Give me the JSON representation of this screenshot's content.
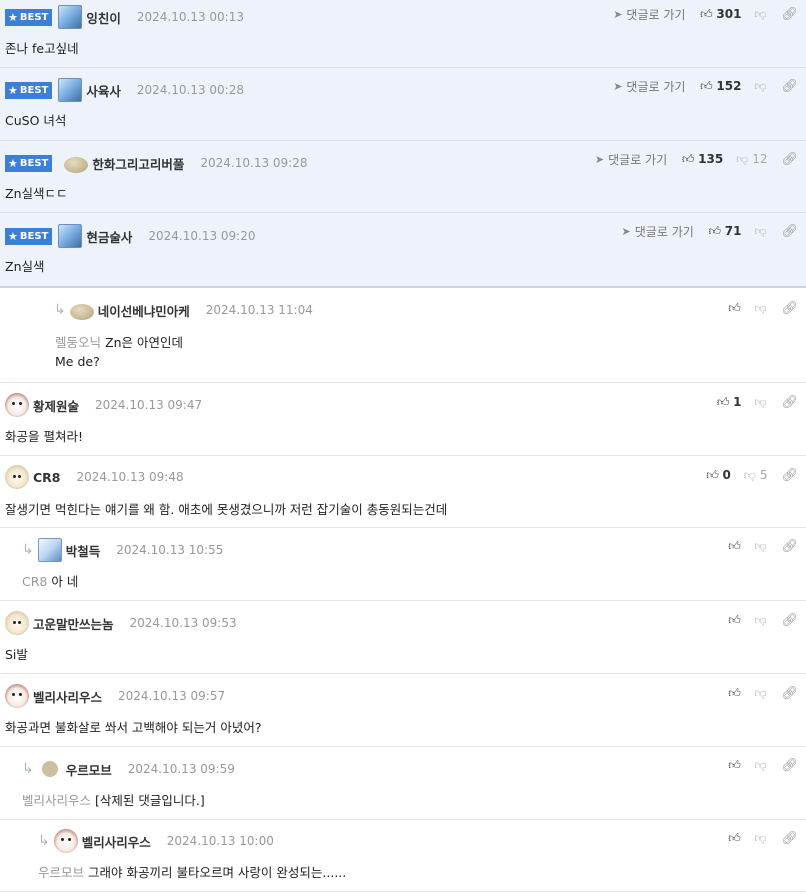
{
  "ui": {
    "best_label": "BEST",
    "goto_label": "댓글로 가기"
  },
  "comments": [
    {
      "nick": "잉친이",
      "date": "2024.10.13 00:13",
      "text": "존나 fe고싶네",
      "up": "301",
      "down": "",
      "best": true
    },
    {
      "nick": "사육사",
      "date": "2024.10.13 00:28",
      "text": "CuSO 녀석",
      "up": "152",
      "down": "",
      "best": true
    },
    {
      "nick": "한화그리고리버풀",
      "date": "2024.10.13 09:28",
      "text": "Zn실색ㄷㄷ",
      "up": "135",
      "down": "12",
      "best": true
    },
    {
      "nick": "현금술사",
      "date": "2024.10.13 09:20",
      "text": "Zn실색",
      "up": "71",
      "down": "",
      "best": true
    },
    {
      "nick": "네이선베냐민아케",
      "date": "2024.10.13 11:04",
      "mention": "렐둥오닉",
      "text": "Zn은 아연인데",
      "text2": "Me de?"
    },
    {
      "nick": "황제원술",
      "date": "2024.10.13 09:47",
      "text": "화공을 펼쳐라!",
      "up": "1",
      "down": ""
    },
    {
      "nick": "CR8",
      "date": "2024.10.13 09:48",
      "text": "잘생기면 먹힌다는 얘기를 왜 함. 애초에 못생겼으니까 저런 잡기술이 총동원되는건데",
      "up": "0",
      "down": "5"
    },
    {
      "nick": "박철득",
      "date": "2024.10.13 10:55",
      "mention": "CR8",
      "text": "아 네"
    },
    {
      "nick": "고운말만쓰는놈",
      "date": "2024.10.13 09:53",
      "text": "Si발"
    },
    {
      "nick": "벨리사리우스",
      "date": "2024.10.13 09:57",
      "text": "화공과면 불화살로 쏴서 고백해야 되는거 아녔어?"
    },
    {
      "nick": "우르모브",
      "date": "2024.10.13 09:59",
      "mention": "벨리사리우스",
      "text": "[삭제된 댓글입니다.]"
    },
    {
      "nick": "벨리사리우스",
      "date": "2024.10.13 10:00",
      "mention": "우르모브",
      "text": "그래야 화공끼리 불타오르며 사랑이 완성되는......"
    }
  ]
}
